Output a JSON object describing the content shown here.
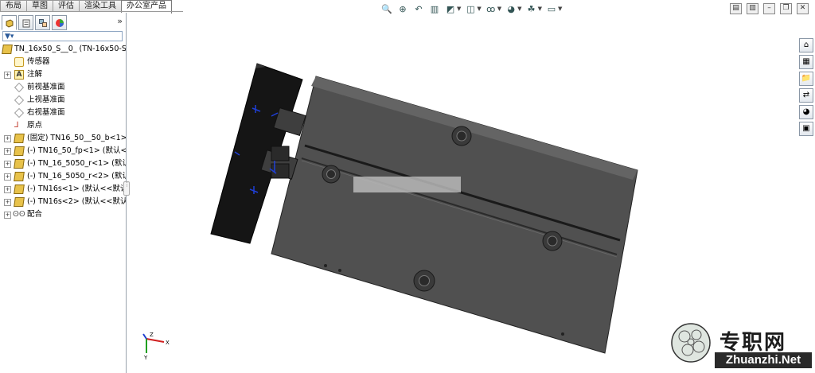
{
  "tabs": [
    {
      "label": "布局"
    },
    {
      "label": "草图"
    },
    {
      "label": "评估"
    },
    {
      "label": "渲染工具"
    },
    {
      "label": "办公室产品"
    }
  ],
  "feature_tree": {
    "filter_icon": "filter-icon",
    "root": "TN_16x50_S__0_  (TN-16x50-S",
    "nodes": [
      {
        "label": "传感器",
        "icon": "sensor-icon"
      },
      {
        "label": "注解",
        "icon": "annotation-icon"
      },
      {
        "label": "前视基准面",
        "icon": "plane-icon"
      },
      {
        "label": "上视基准面",
        "icon": "plane-icon"
      },
      {
        "label": "右视基准面",
        "icon": "plane-icon"
      },
      {
        "label": "原点",
        "icon": "origin-icon"
      },
      {
        "label": "(固定) TN16_50__50_b<1>",
        "icon": "part-icon"
      },
      {
        "label": "(-) TN16_50_fp<1> (默认<",
        "icon": "part-icon"
      },
      {
        "label": "(-) TN_16_5050_r<1> (默认",
        "icon": "part-icon"
      },
      {
        "label": "(-) TN_16_5050_r<2> (默认",
        "icon": "part-icon"
      },
      {
        "label": "(-) TN16s<1> (默认<<默认",
        "icon": "part-icon"
      },
      {
        "label": "(-) TN16s<2> (默认<<默认",
        "icon": "part-icon"
      },
      {
        "label": "配合",
        "icon": "mates-icon"
      }
    ]
  },
  "triad": {
    "x": "X",
    "y": "Y",
    "z": "Z"
  },
  "watermark": {
    "text": "专职网",
    "url": "Zhuanzhi.Net"
  }
}
